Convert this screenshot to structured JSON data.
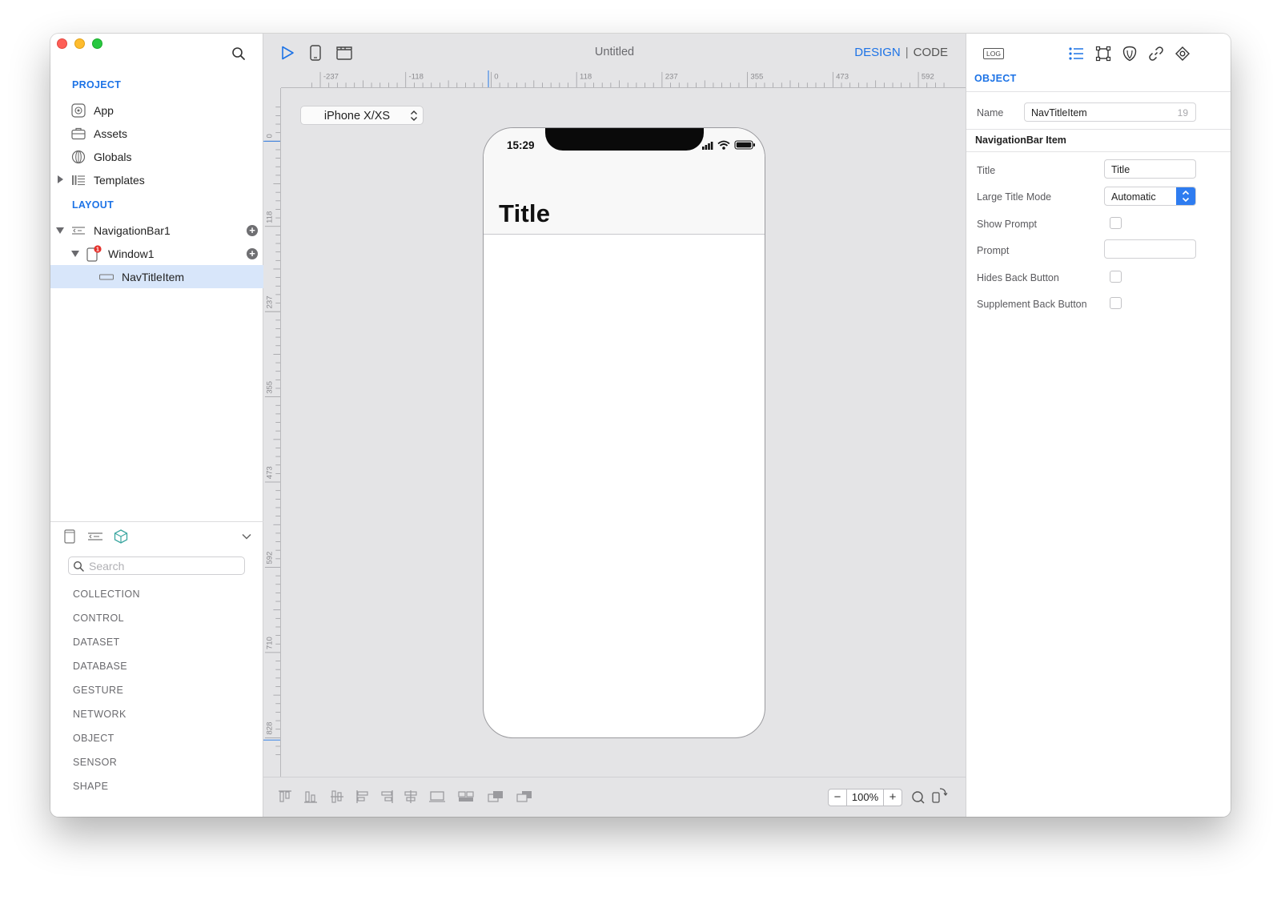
{
  "window": {
    "title": "Untitled"
  },
  "toolbar": {
    "mode_design": "DESIGN",
    "mode_separator": "|",
    "mode_code": "CODE"
  },
  "project": {
    "heading": "PROJECT",
    "items": [
      {
        "label": "App",
        "icon": "app-icon"
      },
      {
        "label": "Assets",
        "icon": "briefcase-icon"
      },
      {
        "label": "Globals",
        "icon": "globe-icon"
      },
      {
        "label": "Templates",
        "icon": "templates-icon"
      }
    ]
  },
  "layout": {
    "heading": "LAYOUT",
    "items": [
      {
        "label": "NavigationBar1",
        "icon": "navigation-bar-icon"
      },
      {
        "label": "Window1",
        "icon": "window-icon",
        "badge": "1"
      },
      {
        "label": "NavTitleItem",
        "icon": "nav-title-item-icon",
        "selected": true
      }
    ]
  },
  "library": {
    "search_placeholder": "Search",
    "categories": [
      "COLLECTION",
      "CONTROL",
      "DATASET",
      "DATABASE",
      "GESTURE",
      "NETWORK",
      "OBJECT",
      "SENSOR",
      "SHAPE"
    ]
  },
  "canvas": {
    "device": "iPhone X/XS",
    "ruler_h_labels": [
      "-237",
      "-118",
      "0",
      "118",
      "237",
      "355",
      "473",
      "592"
    ],
    "ruler_v_labels": [
      "0",
      "118",
      "237",
      "355",
      "473",
      "592",
      "710",
      "828"
    ],
    "phone": {
      "time": "15:29",
      "nav_title": "Title"
    },
    "zoom": {
      "minus": "−",
      "value": "100%",
      "plus": "+"
    }
  },
  "inspector": {
    "log_label": "LOG",
    "section": "OBJECT",
    "name_label": "Name",
    "name_value": "NavTitleItem",
    "name_count": "19",
    "subheading": "NavigationBar Item",
    "props": {
      "title_label": "Title",
      "title_value": "Title",
      "large_title_mode_label": "Large Title Mode",
      "large_title_mode_value": "Automatic",
      "show_prompt_label": "Show Prompt",
      "prompt_label": "Prompt",
      "prompt_value": "",
      "hides_back_button_label": "Hides Back Button",
      "supplement_back_button_label": "Supplement Back Button"
    }
  },
  "colors": {
    "accent": "#1d73e6",
    "selection": "#d8e6fa",
    "badge": "#e5312b"
  }
}
